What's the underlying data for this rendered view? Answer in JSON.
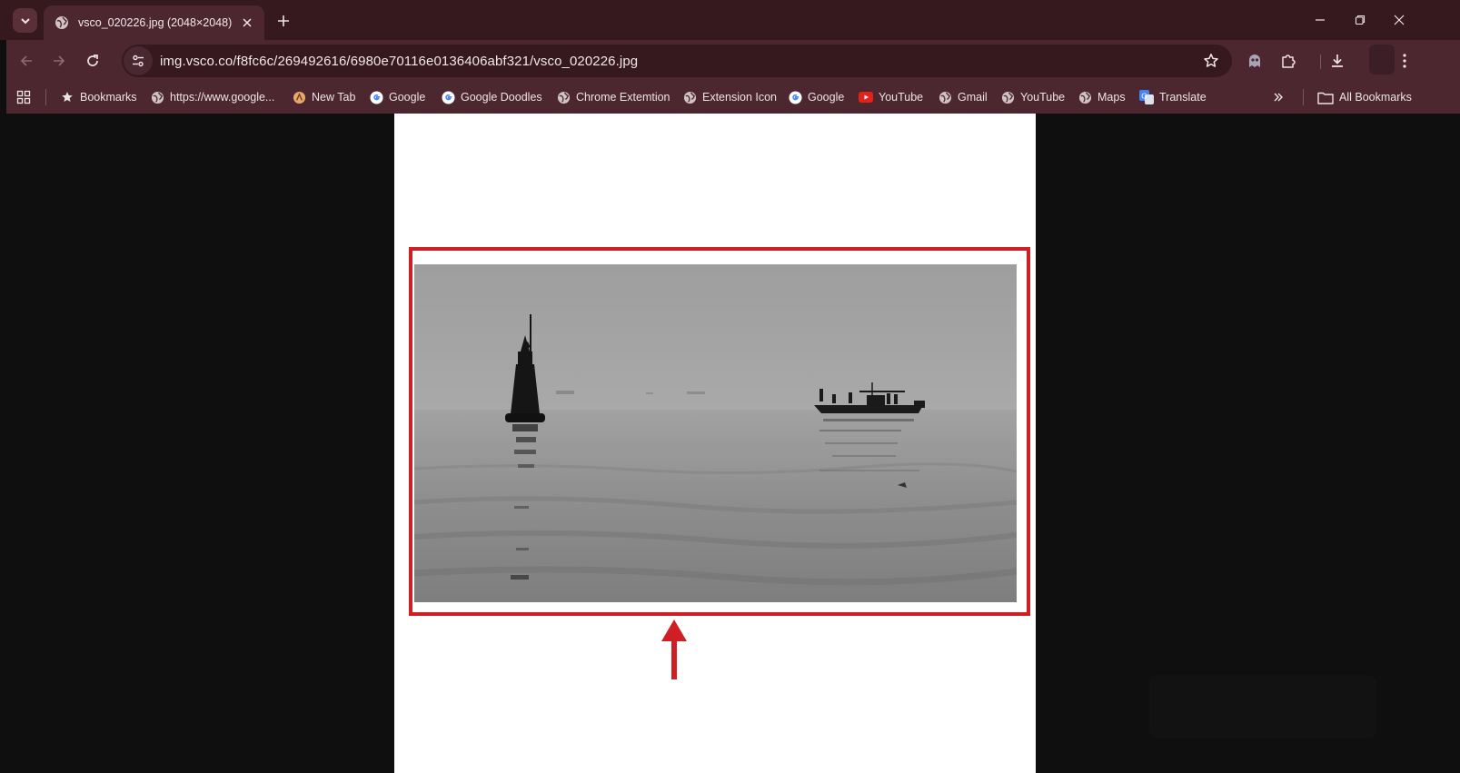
{
  "tab": {
    "title": "vsco_020226.jpg (2048×2048)"
  },
  "omnibox": {
    "url": "img.vsco.co/f8fc6c/269492616/6980e70116e0136406abf321/vsco_020226.jpg"
  },
  "bookmarks": {
    "items": [
      {
        "label": "Bookmarks",
        "icon": "star-icon"
      },
      {
        "label": "https://www.google...",
        "icon": "globe-icon"
      },
      {
        "label": "New Tab",
        "icon": "newtab-icon"
      },
      {
        "label": "Google",
        "icon": "google-icon"
      },
      {
        "label": "Google Doodles",
        "icon": "google-icon"
      },
      {
        "label": "Chrome Extemtion",
        "icon": "globe-icon"
      },
      {
        "label": "Extension Icon",
        "icon": "globe-icon"
      },
      {
        "label": "Google",
        "icon": "google-icon"
      },
      {
        "label": "YouTube",
        "icon": "youtube-icon"
      },
      {
        "label": "Gmail",
        "icon": "globe-icon"
      },
      {
        "label": "YouTube",
        "icon": "globe-icon"
      },
      {
        "label": "Maps",
        "icon": "globe-icon"
      },
      {
        "label": "Translate",
        "icon": "translate-icon"
      }
    ],
    "all_bookmarks": "All Bookmarks"
  },
  "colors": {
    "frame": "#35191f",
    "toolbar": "#4d2730",
    "highlight": "#d01f24",
    "page_bg": "#0f0f0f"
  }
}
